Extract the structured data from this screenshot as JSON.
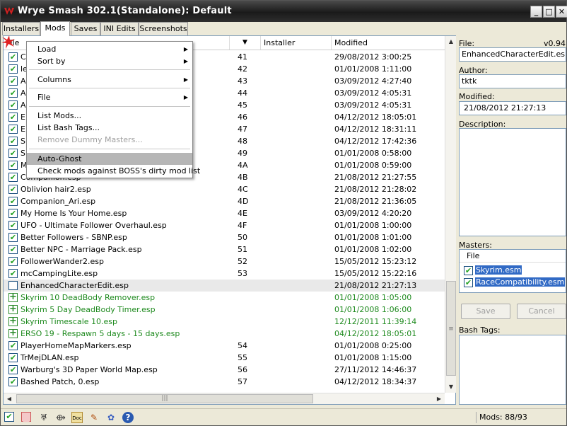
{
  "window": {
    "title": "Wrye Smash 302.1(Standalone): Default"
  },
  "tabs": [
    {
      "label": "Installers"
    },
    {
      "label": "Mods"
    },
    {
      "label": "Saves"
    },
    {
      "label": "INI Edits"
    },
    {
      "label": "Screenshots"
    }
  ],
  "columns": {
    "file": "File",
    "sort_arrow": "▼",
    "installer": "Installer",
    "modified": "Modified"
  },
  "mods": [
    {
      "name": "Companion_Ari.esp",
      "order": "41",
      "modified": "29/08/2012 3:00:25"
    },
    {
      "name": "",
      "order": "42",
      "modified": "01/01/2008 1:11:00"
    },
    {
      "name": "",
      "order": "43",
      "modified": "03/09/2012 4:27:40"
    },
    {
      "name": "",
      "order": "44",
      "modified": "03/09/2012 4:05:31"
    },
    {
      "name": "",
      "order": "45",
      "modified": "03/09/2012 4:05:31"
    },
    {
      "name": "",
      "order": "46",
      "modified": "04/12/2012 18:05:01"
    },
    {
      "name": "",
      "order": "47",
      "modified": "04/12/2012 18:31:11"
    },
    {
      "name": "",
      "order": "48",
      "modified": "04/12/2012 17:42:36"
    },
    {
      "name": "",
      "order": "49",
      "modified": "01/01/2008 0:58:00"
    },
    {
      "name": "",
      "order": "4A",
      "modified": "01/01/2008 0:59:00"
    },
    {
      "name": "",
      "order": "4B",
      "modified": "21/08/2012 21:27:55"
    },
    {
      "name": "Oblivion hair2.esp",
      "order": "4C",
      "modified": "21/08/2012 21:28:02"
    },
    {
      "name": "Companion_Ari.esp",
      "order": "4D",
      "modified": "21/08/2012 21:36:05"
    },
    {
      "name": "My Home Is Your Home.esp",
      "order": "4E",
      "modified": "03/09/2012 4:20:20"
    },
    {
      "name": "UFO - Ultimate Follower Overhaul.esp",
      "order": "4F",
      "modified": "01/01/2008 1:00:00"
    },
    {
      "name": "Better Followers - SBNP.esp",
      "order": "50",
      "modified": "01/01/2008 1:01:00"
    },
    {
      "name": "Better NPC - Marriage Pack.esp",
      "order": "51",
      "modified": "01/01/2008 1:02:00"
    },
    {
      "name": "FollowerWander2.esp",
      "order": "52",
      "modified": "15/05/2012 15:23:12"
    },
    {
      "name": "mcCampingLite.esp",
      "order": "53",
      "modified": "15/05/2012 15:22:16"
    },
    {
      "name": "EnhancedCharacterEdit.esp",
      "order": "",
      "modified": "21/08/2012 21:27:13"
    },
    {
      "name": "Skyrim 10 DeadBody Remover.esp",
      "order": "",
      "modified": "01/01/2008 1:05:00"
    },
    {
      "name": "Skyrim 5 Day DeadBody Timer.esp",
      "order": "",
      "modified": "01/01/2008 1:06:00"
    },
    {
      "name": "Skyrim Timescale 10.esp",
      "order": "",
      "modified": "12/12/2011 11:39:14"
    },
    {
      "name": "ERSO 19 - Respawn 5 days - 15 days.esp",
      "order": "",
      "modified": "04/12/2012 18:05:01"
    },
    {
      "name": "PlayerHomeMapMarkers.esp",
      "order": "54",
      "modified": "01/01/2008 0:25:00"
    },
    {
      "name": "TrMejDLAN.esp",
      "order": "55",
      "modified": "01/01/2008 1:15:00"
    },
    {
      "name": "Warburg's 3D Paper World Map.esp",
      "order": "56",
      "modified": "27/11/2012 14:46:37"
    },
    {
      "name": "Bashed Patch, 0.esp",
      "order": "57",
      "modified": "04/12/2012 18:34:37"
    }
  ],
  "row_partial_names": [
    "C",
    "le",
    "A",
    "A",
    "A",
    "E",
    "E",
    "S",
    "S",
    "M",
    "Companion.esp"
  ],
  "context_menu": {
    "load": "Load",
    "sort_by": "Sort by",
    "columns": "Columns",
    "file": "File",
    "list_mods": "List Mods...",
    "list_bash_tags": "List Bash Tags...",
    "remove_dummy_masters": "Remove Dummy Masters...",
    "auto_ghost": "Auto-Ghost",
    "check_boss": "Check mods against BOSS's dirty mod list",
    "submenu_arrow": "▶"
  },
  "details": {
    "file_label": "File:",
    "version": "v0.94",
    "file_value": "EnhancedCharacterEdit.esp",
    "author_label": "Author:",
    "author_value": "tktk",
    "modified_label": "Modified:",
    "modified_value": "21/08/2012 21:27:13",
    "description_label": "Description:",
    "masters_label": "Masters:",
    "masters_col": "File",
    "masters": [
      "Skyrim.esm",
      "RaceCompatibility.esm"
    ],
    "save_label": "Save",
    "cancel_label": "Cancel",
    "bash_tags_label": "Bash Tags:"
  },
  "status": {
    "mods_count": "Mods: 88/93"
  },
  "scroll": {
    "grip": "≡",
    "hgrip": "|||",
    "up": "▲",
    "down": "▼",
    "left": "◀",
    "right": "▶"
  },
  "window_buttons": {
    "minimize": "_",
    "maximize": "□",
    "close": "✕"
  },
  "status_icons": {
    "check": "✔",
    "box": "■",
    "tool": "♅",
    "link": "⟴",
    "doc": "Doc",
    "edit": "✎",
    "gear": "✿",
    "help": "?"
  },
  "colors": {
    "title_bg": "#1f1f1f",
    "selection": "#316ac5",
    "ghost_green": "#1e8a1e",
    "check_green": "#21a121"
  }
}
